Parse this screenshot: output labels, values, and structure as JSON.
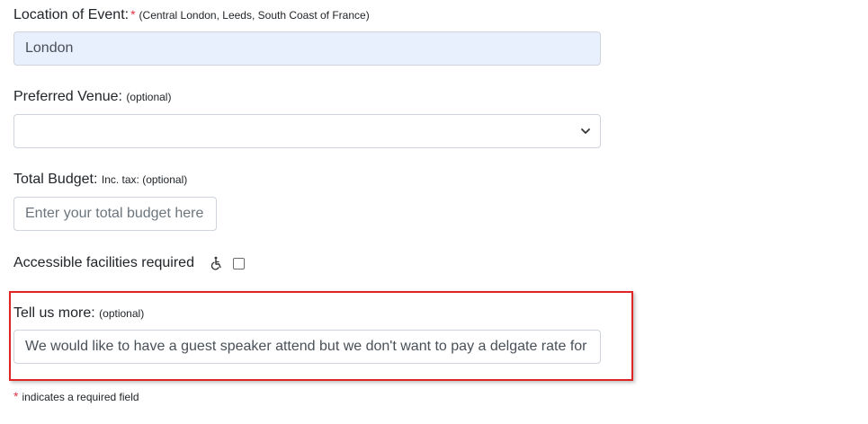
{
  "location": {
    "label": "Location of Event:",
    "required_mark": "*",
    "hint": "(Central London, Leeds, South Coast of France)",
    "value": "London"
  },
  "venue": {
    "label": "Preferred Venue:",
    "hint": "(optional)",
    "value": ""
  },
  "budget": {
    "label": "Total Budget:",
    "hint": "Inc. tax: (optional)",
    "placeholder": "Enter your total budget here"
  },
  "accessible": {
    "label": "Accessible facilities required",
    "icon": "wheelchair-icon",
    "checked": false
  },
  "more": {
    "label": "Tell us more:",
    "hint": "(optional)",
    "value": "We would like to have a guest speaker attend but we don't want to pay a delgate rate for"
  },
  "footnote": {
    "star": "*",
    "text": "indicates a required field"
  },
  "colors": {
    "required": "#dc3545",
    "highlight_border": "#e02424",
    "autofill_bg": "#e8f0fe"
  }
}
